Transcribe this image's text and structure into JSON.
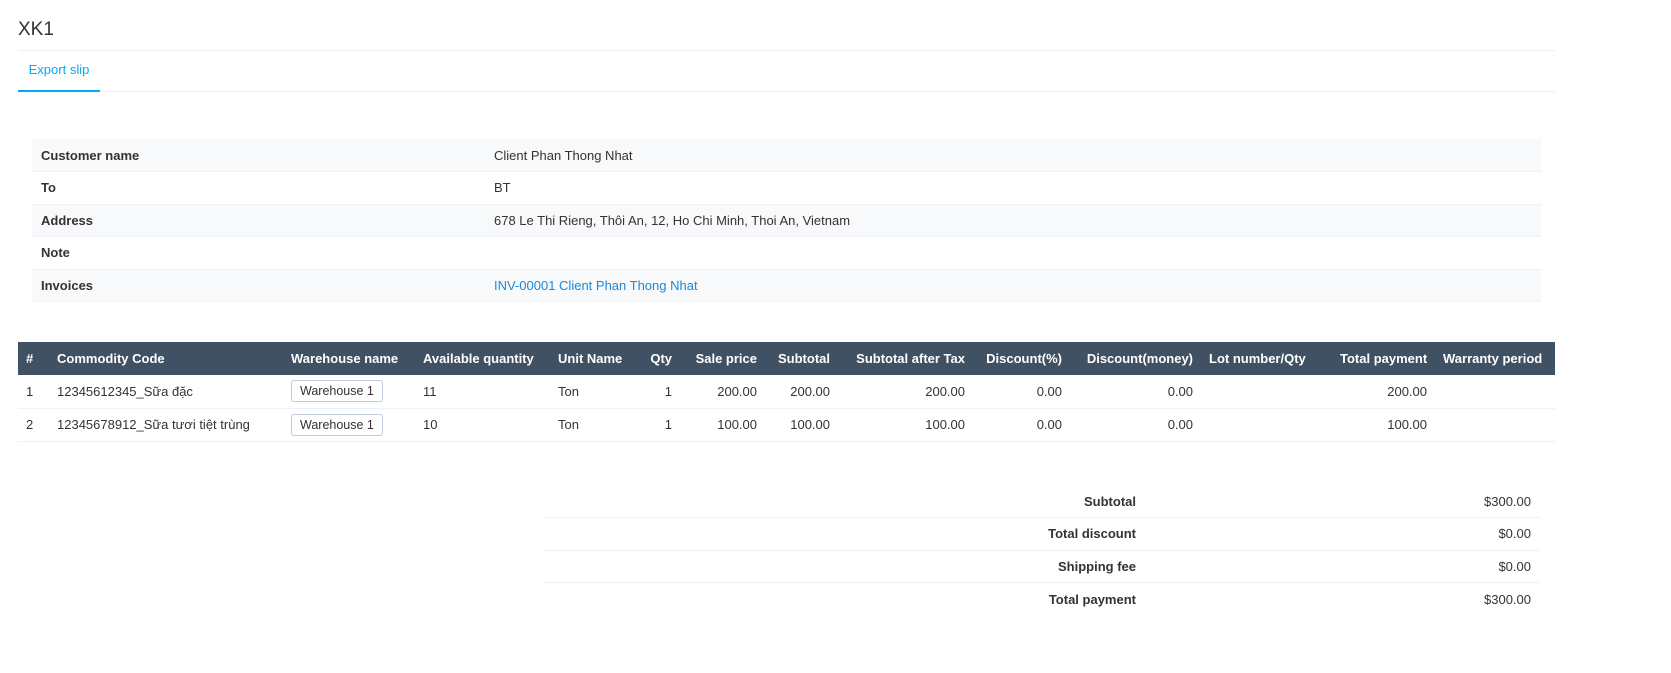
{
  "title": "XK1",
  "tabs": [
    {
      "label": "Export slip",
      "active": true
    }
  ],
  "info": [
    {
      "label": "Customer name",
      "value": "Client Phan Thong Nhat"
    },
    {
      "label": "To",
      "value": "BT"
    },
    {
      "label": "Address",
      "value": "678 Le Thi Rieng, Thôi An, 12, Ho Chi Minh, Thoi An, Vietnam"
    },
    {
      "label": "Note",
      "value": ""
    },
    {
      "label": "Invoices",
      "value": "INV-00001 Client Phan Thong Nhat",
      "link": true
    }
  ],
  "table": {
    "headers": [
      "#",
      "Commodity Code",
      "Warehouse name",
      "Available quantity",
      "Unit Name",
      "Qty",
      "Sale price",
      "Subtotal",
      "Subtotal after Tax",
      "Discount(%)",
      "Discount(money)",
      "Lot number/Qty",
      "Total payment",
      "Warranty period"
    ],
    "rows": [
      [
        "1",
        "12345612345_Sữa đặc",
        "Warehouse 1",
        "11",
        "Ton",
        "1",
        "200.00",
        "200.00",
        "200.00",
        "0.00",
        "0.00",
        "",
        "200.00",
        ""
      ],
      [
        "2",
        "12345678912_Sữa tươi tiệt trùng",
        "Warehouse 1",
        "10",
        "Ton",
        "1",
        "100.00",
        "100.00",
        "100.00",
        "0.00",
        "0.00",
        "",
        "100.00",
        ""
      ]
    ]
  },
  "summary": [
    {
      "label": "Subtotal",
      "value": "$300.00"
    },
    {
      "label": "Total discount",
      "value": "$0.00"
    },
    {
      "label": "Shipping fee",
      "value": "$0.00"
    },
    {
      "label": "Total payment",
      "value": "$300.00"
    }
  ],
  "colors": {
    "accent": "#03a9f4",
    "header_bg": "#415164",
    "link": "#1f87d4"
  }
}
